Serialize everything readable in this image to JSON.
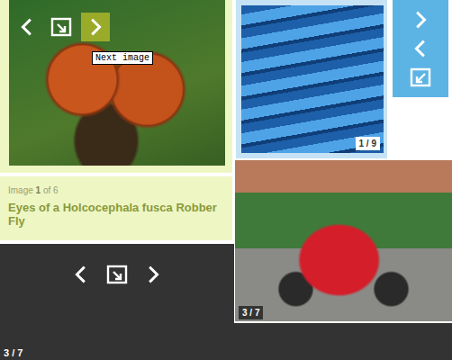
{
  "fly_viewer": {
    "buttons": [
      {
        "hovered": false
      },
      {
        "hovered": false
      },
      {
        "hovered": true
      }
    ],
    "tooltip": "Next image"
  },
  "chairs_viewer": {
    "counter": "1 / 9"
  },
  "caption": {
    "label_before": "Image ",
    "current": "1",
    "label_after": " of 6",
    "title": "Eyes of a Holcocephala fusca Robber Fly"
  },
  "dark_viewer": {
    "counter": "3 / 7"
  },
  "car_viewer": {
    "counter": "3 / 7"
  }
}
